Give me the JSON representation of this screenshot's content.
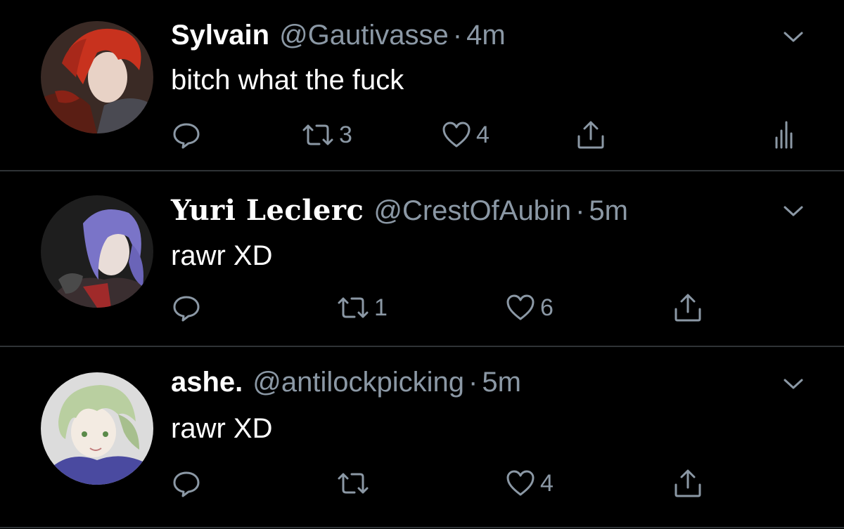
{
  "tweets": [
    {
      "name": "Sylvain",
      "handle": "@Gautivasse",
      "separator": "·",
      "time": "4m",
      "text": "bitch what the fuck",
      "avatar_colors": {
        "hair": "#c8321e",
        "background": "#3a2a25",
        "skin": "#e8d2c6"
      },
      "actions": {
        "retweets": "3",
        "likes": "4"
      },
      "has_analytics": true
    },
    {
      "name": "Yuri Leclerc",
      "handle": "@CrestOfAubin",
      "separator": "·",
      "time": "5m",
      "text": "rawr XD",
      "avatar_colors": {
        "hair": "#7a74c8",
        "background": "#1e1e1e",
        "skin": "#e9ddd8"
      },
      "actions": {
        "retweets": "1",
        "likes": "6"
      },
      "has_analytics": false
    },
    {
      "name": "ashe.",
      "handle": "@antilockpicking",
      "separator": "·",
      "time": "5m",
      "text": "rawr XD",
      "avatar_colors": {
        "hair": "#b9cfa0",
        "background": "#dcdcdc",
        "skin": "#f3ebe2"
      },
      "actions": {
        "retweets": "",
        "likes": "4"
      },
      "has_analytics": false
    }
  ],
  "icons": {
    "reply": "reply-icon",
    "retweet": "retweet-icon",
    "like": "heart-icon",
    "share": "share-icon",
    "analytics": "analytics-icon",
    "more": "chevron-down-icon"
  },
  "colors": {
    "background": "#000000",
    "secondary_text": "#8b98a5",
    "divider": "#2f3336"
  }
}
